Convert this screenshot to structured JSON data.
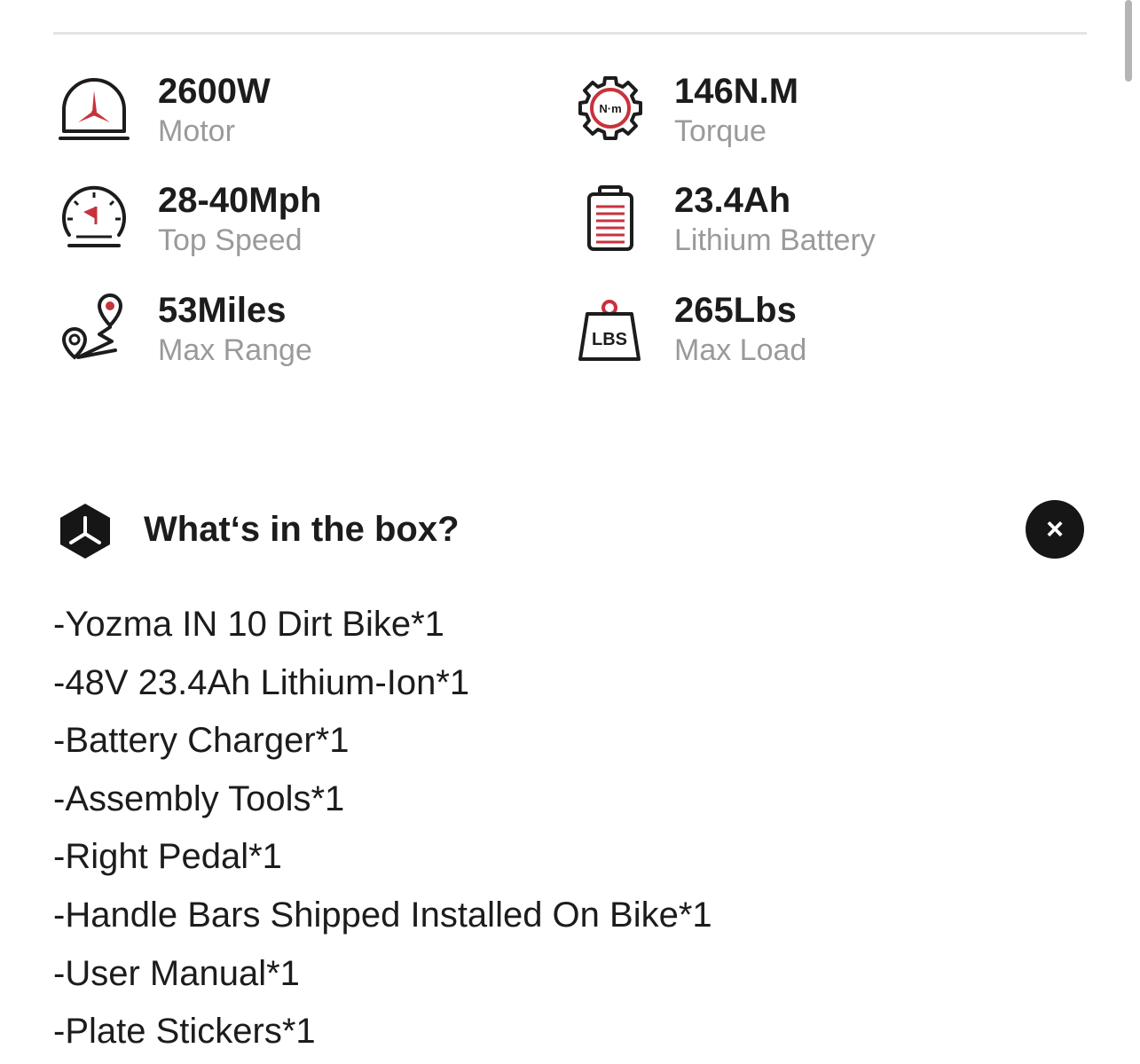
{
  "specs": [
    {
      "id": "motor",
      "icon": "motor-icon",
      "value": "2600W",
      "label": "Motor"
    },
    {
      "id": "torque",
      "icon": "torque-gear-icon",
      "icon_text": "N·m",
      "value": "146N.M",
      "label": "Torque"
    },
    {
      "id": "speed",
      "icon": "speedometer-icon",
      "value": "28-40Mph",
      "label": "Top Speed"
    },
    {
      "id": "battery",
      "icon": "battery-icon",
      "value": "23.4Ah",
      "label": "Lithium Battery"
    },
    {
      "id": "range",
      "icon": "route-pin-icon",
      "value": "53Miles",
      "label": "Max Range"
    },
    {
      "id": "load",
      "icon": "weight-icon",
      "icon_text": "LBS",
      "value": "265Lbs",
      "label": "Max Load"
    }
  ],
  "box": {
    "title": "What‘s in the box?",
    "close_label": "×",
    "items": [
      "-Yozma IN 10 Dirt Bike*1",
      "-48V 23.4Ah Lithium-Ion*1",
      "-Battery Charger*1",
      "-Assembly Tools*1",
      "-Right Pedal*1",
      "-Handle Bars Shipped Installed On Bike*1",
      "-User Manual*1",
      "-Plate Stickers*1"
    ]
  },
  "colors": {
    "accent": "#c8323c",
    "text": "#1c1c1c",
    "muted": "#9a9a9a"
  }
}
